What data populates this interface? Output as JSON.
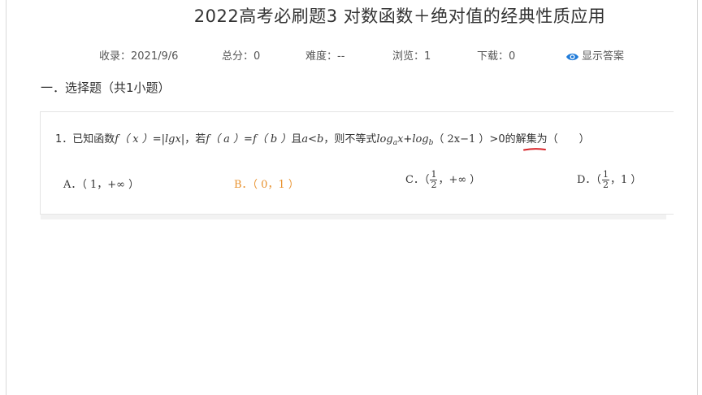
{
  "page": {
    "title": "2022高考必刷题3  对数函数＋绝对值的经典性质应用"
  },
  "meta": {
    "recorded": "收录：2021/9/6",
    "score": "总分：0",
    "difficulty": "难度：--",
    "views": "浏览：1",
    "downloads": "下载：0",
    "show_answer": "显示答案",
    "accent_color": "#1f7bd9"
  },
  "section": {
    "title": "一．选择题（共1小题）"
  },
  "question": {
    "number": "1．",
    "text_parts": {
      "p1": "已知函数",
      "fx": "f（ x ）",
      "eq1": "=|",
      "lgx": "lgx",
      "p2": "|，若",
      "fa": "f（ a ）",
      "eq2": "=",
      "fb": "f（ b ）",
      "p3": "且",
      "a": "a",
      "lt": "<",
      "b": "b",
      "p4": "，则不等式",
      "log": "log",
      "sub_a": "a",
      "x": "x",
      "plus": "+",
      "log2": "log",
      "sub_b": "b",
      "arg": "（ 2x−1 ）",
      "gt": ">0的",
      "p5": "解集为（　　）"
    },
    "options": {
      "A": "A．（ 1，+∞ ）",
      "B": "B．（ 0，1 ）",
      "C_prefix": "C．（",
      "C_num": "1",
      "C_den": "2",
      "C_suffix": "，+∞ ）",
      "D_prefix": "D．（",
      "D_num": "1",
      "D_den": "2",
      "D_suffix": "，1 ）"
    },
    "selected_option": "B",
    "selected_color": "#e8912d",
    "annotation_color": "#d9262b"
  }
}
